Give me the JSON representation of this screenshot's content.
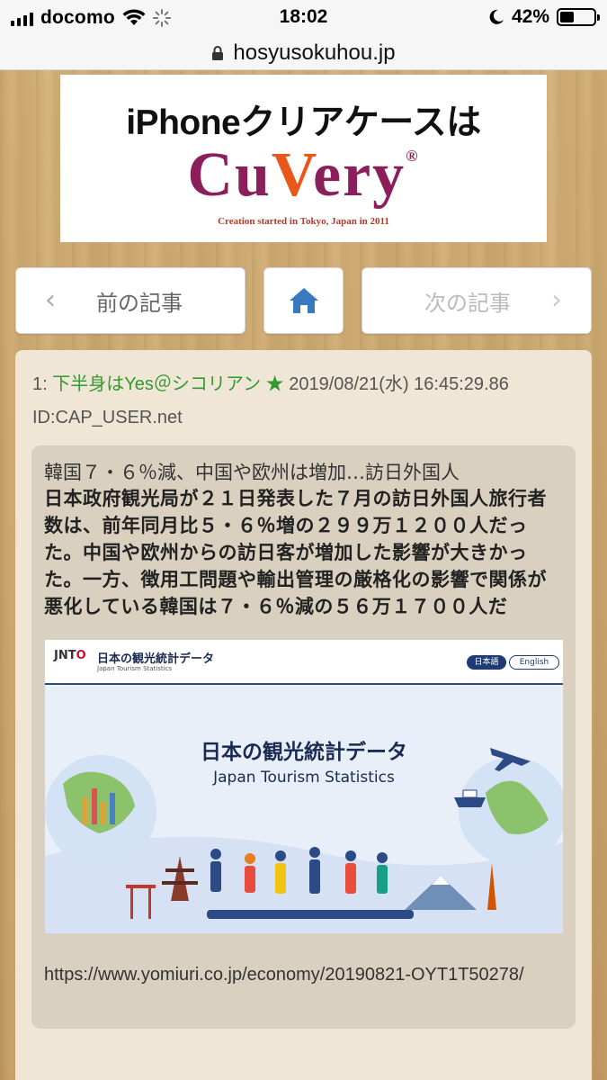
{
  "status_bar": {
    "carrier": "docomo",
    "time": "18:02",
    "battery_percent": "42%",
    "battery_level": 0.42,
    "icons": [
      "signal-icon",
      "wifi-icon",
      "loading-spinner-icon",
      "moon-icon",
      "battery-icon"
    ]
  },
  "browser": {
    "url": "hosyusokuhou.jp",
    "icons": [
      "lock-icon"
    ]
  },
  "ad": {
    "line1": "iPhoneクリアケースは",
    "brand_pre": "Cu",
    "brand_v": "V",
    "brand_post": "ery",
    "brand_mark": "®",
    "tagline": "Creation started in Tokyo, Japan in 2011",
    "colors": {
      "brand": "#8a1f5b",
      "v_accent": "#e8581b"
    }
  },
  "nav": {
    "prev_label": "前の記事",
    "next_label": "次の記事",
    "home_icon": "home-icon",
    "home_color": "#3a78c2"
  },
  "post": {
    "number": "1:",
    "name": "下半身はYes＠シコリアン ★",
    "date": "2019/08/21(水) 16:45:29.86",
    "id": "ID:CAP_USER.net",
    "name_color": "#339933"
  },
  "quote": {
    "title": "韓国７・６％減、中国や欧州は増加…訪日外国人",
    "body": "日本政府観光局が２１日発表した７月の訪日外国人旅行者数は、前年同月比５・６％増の２９９万１２００人だった。中国や欧州からの訪日客が増加した影響が大きかった。一方、徴用工問題や輸出管理の厳格化の影響で関係が悪化している韓国は７・６％減の５６万１７００人だ",
    "link": "https://www.yomiuri.co.jp/economy/20190821-OYT1T50278/"
  },
  "embedded_image": {
    "logo_pre": "JNT",
    "logo_o": "O",
    "header_title": "日本の観光統計データ",
    "header_subtitle": "Japan Tourism Statistics",
    "lang_jp": "日本語",
    "lang_en": "English",
    "main_title": "日本の観光統計データ",
    "main_subtitle": "Japan Tourism Statistics"
  }
}
